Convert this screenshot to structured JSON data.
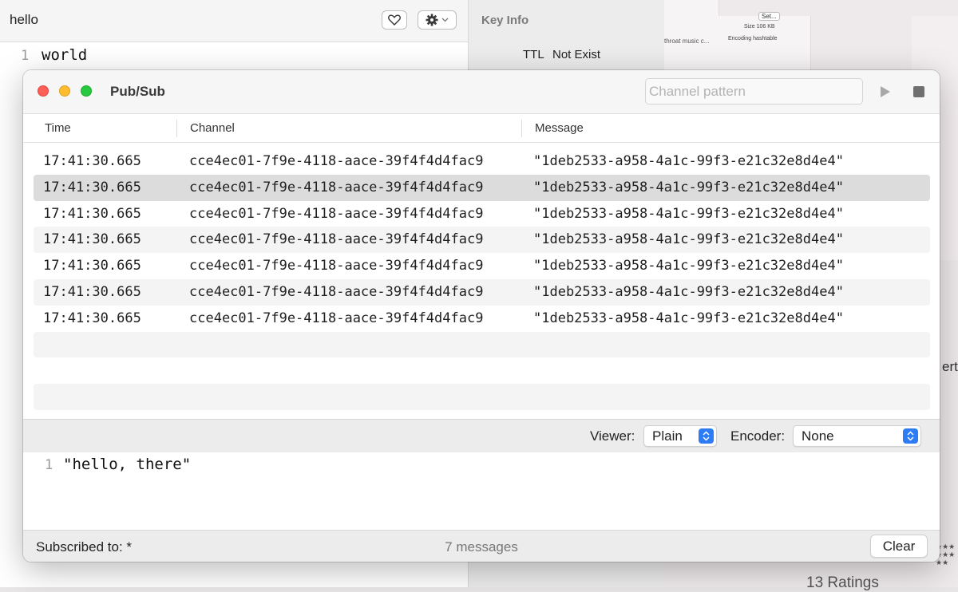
{
  "background_editor": {
    "key_name": "hello",
    "line_number": "1",
    "line_text": "world",
    "key_info_title": "Key Info",
    "ttl_label": "TTL",
    "ttl_value": "Not Exist"
  },
  "background_right": {
    "track_label": "throat music c...",
    "set_button": "Set...",
    "size_label": "Size",
    "size_value": "106 KB",
    "encoding_label": "Encoding",
    "encoding_value": "hashtable",
    "cut_text": "ert",
    "ratings": "13 Ratings",
    "stars": "★★★★★★★★"
  },
  "pubsub": {
    "title": "Pub/Sub",
    "channel_placeholder": "Channel pattern",
    "columns": {
      "time": "Time",
      "channel": "Channel",
      "message": "Message"
    },
    "rows": [
      {
        "time": "17:41:30.665",
        "channel": "cce4ec01-7f9e-4118-aace-39f4f4d4fac9",
        "message": "\"1deb2533-a958-4a1c-99f3-e21c32e8d4e4\""
      },
      {
        "time": "17:41:30.665",
        "channel": "cce4ec01-7f9e-4118-aace-39f4f4d4fac9",
        "message": "\"1deb2533-a958-4a1c-99f3-e21c32e8d4e4\""
      },
      {
        "time": "17:41:30.665",
        "channel": "cce4ec01-7f9e-4118-aace-39f4f4d4fac9",
        "message": "\"1deb2533-a958-4a1c-99f3-e21c32e8d4e4\""
      },
      {
        "time": "17:41:30.665",
        "channel": "cce4ec01-7f9e-4118-aace-39f4f4d4fac9",
        "message": "\"1deb2533-a958-4a1c-99f3-e21c32e8d4e4\""
      },
      {
        "time": "17:41:30.665",
        "channel": "cce4ec01-7f9e-4118-aace-39f4f4d4fac9",
        "message": "\"1deb2533-a958-4a1c-99f3-e21c32e8d4e4\""
      },
      {
        "time": "17:41:30.665",
        "channel": "cce4ec01-7f9e-4118-aace-39f4f4d4fac9",
        "message": "\"1deb2533-a958-4a1c-99f3-e21c32e8d4e4\""
      },
      {
        "time": "17:41:30.665",
        "channel": "cce4ec01-7f9e-4118-aace-39f4f4d4fac9",
        "message": "\"1deb2533-a958-4a1c-99f3-e21c32e8d4e4\""
      }
    ],
    "selected_row": 1,
    "viewer_label": "Viewer:",
    "viewer_value": "Plain",
    "encoder_label": "Encoder:",
    "encoder_value": "None",
    "body_line_number": "1",
    "body_text": "\"hello, there\"",
    "subscribed_label": "Subscribed to: *",
    "message_count": "7 messages",
    "clear_label": "Clear"
  },
  "colors": {
    "accent": "#2d7cf6",
    "close": "#ff5f57",
    "minimize": "#febc2e",
    "maximize": "#28c840"
  },
  "icons": {
    "favorite": "heart-icon",
    "settings": "gear-icon",
    "play": "play-icon",
    "stop": "stop-icon",
    "popup": "up-down-chevron-icon"
  }
}
